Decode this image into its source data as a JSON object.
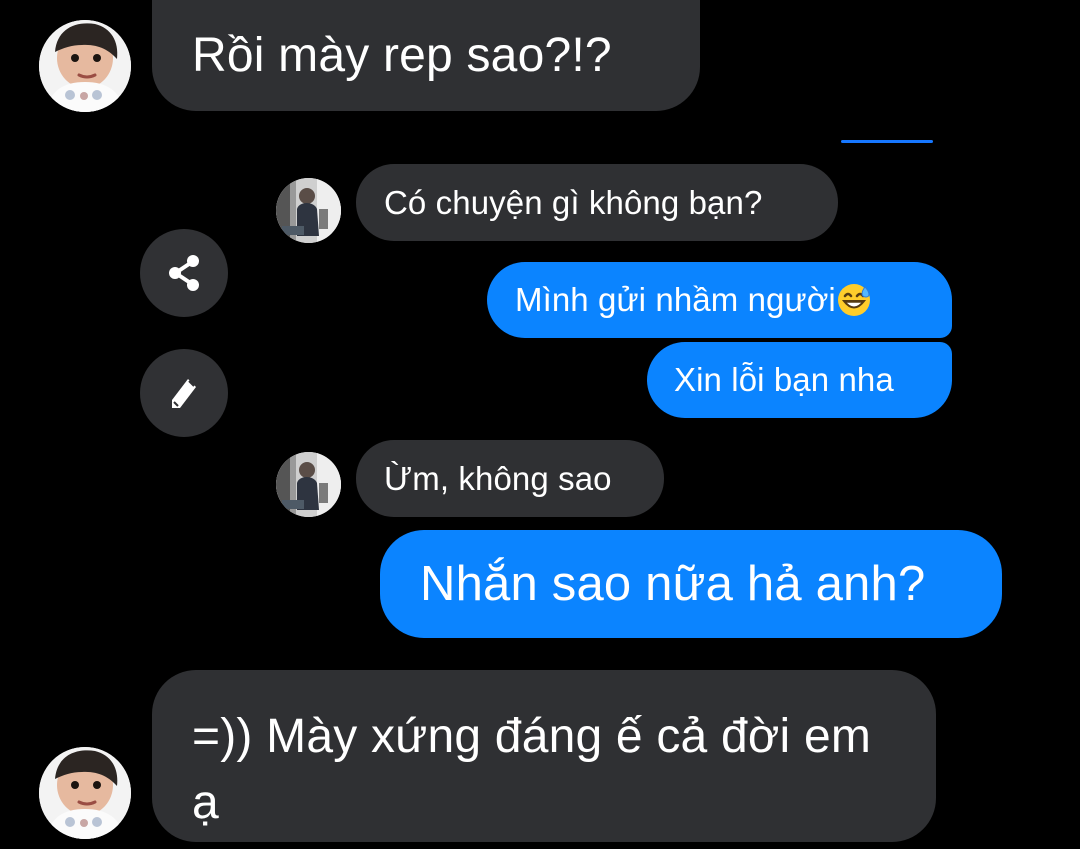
{
  "messages": [
    {
      "sender": "friend",
      "text": "Rồi mày rep sao?!?"
    },
    {
      "sender": "other",
      "text": "Có chuyện gì không bạn?"
    },
    {
      "sender": "me",
      "text": "Mình gửi nhầm người",
      "emoji": "grinning-sweat-emoji"
    },
    {
      "sender": "me",
      "text": "Xin lỗi bạn nha"
    },
    {
      "sender": "other",
      "text": "Ừm, không sao"
    },
    {
      "sender": "me",
      "text": "Nhắn sao nữa hả anh?"
    },
    {
      "sender": "friend",
      "text": "=)) Mày xứng đáng ế cả đời em ạ"
    }
  ],
  "actions": {
    "share_icon": "share-icon",
    "edit_icon": "pencil-icon"
  },
  "colors": {
    "background": "#000000",
    "incoming_bubble": "#2f3033",
    "outgoing_bubble": "#0b84ff",
    "text": "#ffffff",
    "action_button": "#303134",
    "scroll_indicator": "#1677ff"
  }
}
